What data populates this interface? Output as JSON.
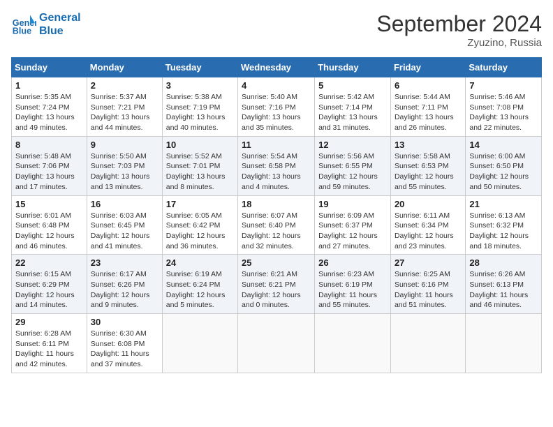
{
  "header": {
    "logo_line1": "General",
    "logo_line2": "Blue",
    "month_title": "September 2024",
    "subtitle": "Zyuzino, Russia"
  },
  "days_of_week": [
    "Sunday",
    "Monday",
    "Tuesday",
    "Wednesday",
    "Thursday",
    "Friday",
    "Saturday"
  ],
  "weeks": [
    [
      {
        "day": "1",
        "info": "Sunrise: 5:35 AM\nSunset: 7:24 PM\nDaylight: 13 hours\nand 49 minutes."
      },
      {
        "day": "2",
        "info": "Sunrise: 5:37 AM\nSunset: 7:21 PM\nDaylight: 13 hours\nand 44 minutes."
      },
      {
        "day": "3",
        "info": "Sunrise: 5:38 AM\nSunset: 7:19 PM\nDaylight: 13 hours\nand 40 minutes."
      },
      {
        "day": "4",
        "info": "Sunrise: 5:40 AM\nSunset: 7:16 PM\nDaylight: 13 hours\nand 35 minutes."
      },
      {
        "day": "5",
        "info": "Sunrise: 5:42 AM\nSunset: 7:14 PM\nDaylight: 13 hours\nand 31 minutes."
      },
      {
        "day": "6",
        "info": "Sunrise: 5:44 AM\nSunset: 7:11 PM\nDaylight: 13 hours\nand 26 minutes."
      },
      {
        "day": "7",
        "info": "Sunrise: 5:46 AM\nSunset: 7:08 PM\nDaylight: 13 hours\nand 22 minutes."
      }
    ],
    [
      {
        "day": "8",
        "info": "Sunrise: 5:48 AM\nSunset: 7:06 PM\nDaylight: 13 hours\nand 17 minutes."
      },
      {
        "day": "9",
        "info": "Sunrise: 5:50 AM\nSunset: 7:03 PM\nDaylight: 13 hours\nand 13 minutes."
      },
      {
        "day": "10",
        "info": "Sunrise: 5:52 AM\nSunset: 7:01 PM\nDaylight: 13 hours\nand 8 minutes."
      },
      {
        "day": "11",
        "info": "Sunrise: 5:54 AM\nSunset: 6:58 PM\nDaylight: 13 hours\nand 4 minutes."
      },
      {
        "day": "12",
        "info": "Sunrise: 5:56 AM\nSunset: 6:55 PM\nDaylight: 12 hours\nand 59 minutes."
      },
      {
        "day": "13",
        "info": "Sunrise: 5:58 AM\nSunset: 6:53 PM\nDaylight: 12 hours\nand 55 minutes."
      },
      {
        "day": "14",
        "info": "Sunrise: 6:00 AM\nSunset: 6:50 PM\nDaylight: 12 hours\nand 50 minutes."
      }
    ],
    [
      {
        "day": "15",
        "info": "Sunrise: 6:01 AM\nSunset: 6:48 PM\nDaylight: 12 hours\nand 46 minutes."
      },
      {
        "day": "16",
        "info": "Sunrise: 6:03 AM\nSunset: 6:45 PM\nDaylight: 12 hours\nand 41 minutes."
      },
      {
        "day": "17",
        "info": "Sunrise: 6:05 AM\nSunset: 6:42 PM\nDaylight: 12 hours\nand 36 minutes."
      },
      {
        "day": "18",
        "info": "Sunrise: 6:07 AM\nSunset: 6:40 PM\nDaylight: 12 hours\nand 32 minutes."
      },
      {
        "day": "19",
        "info": "Sunrise: 6:09 AM\nSunset: 6:37 PM\nDaylight: 12 hours\nand 27 minutes."
      },
      {
        "day": "20",
        "info": "Sunrise: 6:11 AM\nSunset: 6:34 PM\nDaylight: 12 hours\nand 23 minutes."
      },
      {
        "day": "21",
        "info": "Sunrise: 6:13 AM\nSunset: 6:32 PM\nDaylight: 12 hours\nand 18 minutes."
      }
    ],
    [
      {
        "day": "22",
        "info": "Sunrise: 6:15 AM\nSunset: 6:29 PM\nDaylight: 12 hours\nand 14 minutes."
      },
      {
        "day": "23",
        "info": "Sunrise: 6:17 AM\nSunset: 6:26 PM\nDaylight: 12 hours\nand 9 minutes."
      },
      {
        "day": "24",
        "info": "Sunrise: 6:19 AM\nSunset: 6:24 PM\nDaylight: 12 hours\nand 5 minutes."
      },
      {
        "day": "25",
        "info": "Sunrise: 6:21 AM\nSunset: 6:21 PM\nDaylight: 12 hours\nand 0 minutes."
      },
      {
        "day": "26",
        "info": "Sunrise: 6:23 AM\nSunset: 6:19 PM\nDaylight: 11 hours\nand 55 minutes."
      },
      {
        "day": "27",
        "info": "Sunrise: 6:25 AM\nSunset: 6:16 PM\nDaylight: 11 hours\nand 51 minutes."
      },
      {
        "day": "28",
        "info": "Sunrise: 6:26 AM\nSunset: 6:13 PM\nDaylight: 11 hours\nand 46 minutes."
      }
    ],
    [
      {
        "day": "29",
        "info": "Sunrise: 6:28 AM\nSunset: 6:11 PM\nDaylight: 11 hours\nand 42 minutes."
      },
      {
        "day": "30",
        "info": "Sunrise: 6:30 AM\nSunset: 6:08 PM\nDaylight: 11 hours\nand 37 minutes."
      },
      {
        "day": "",
        "info": ""
      },
      {
        "day": "",
        "info": ""
      },
      {
        "day": "",
        "info": ""
      },
      {
        "day": "",
        "info": ""
      },
      {
        "day": "",
        "info": ""
      }
    ]
  ]
}
